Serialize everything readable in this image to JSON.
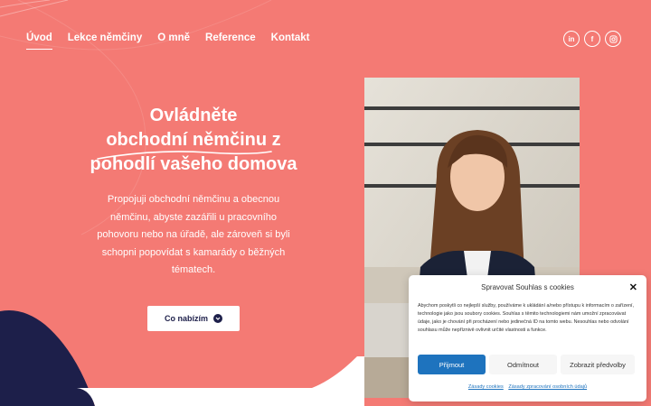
{
  "nav": {
    "items": [
      {
        "label": "Úvod",
        "active": true
      },
      {
        "label": "Lekce němčiny",
        "active": false
      },
      {
        "label": "O mně",
        "active": false
      },
      {
        "label": "Reference",
        "active": false
      },
      {
        "label": "Kontakt",
        "active": false
      }
    ]
  },
  "social": {
    "linkedin": "in",
    "facebook": "f",
    "instagram_icon": "instagram-icon"
  },
  "hero": {
    "title_line1": "Ovládněte",
    "title_line2": "obchodní němčinu z",
    "title_line3": "pohodlí vašeho domova",
    "text": "Propojuji obchodní němčinu a obecnou němčinu, abyste zazářili u pracovního pohovoru nebo na úřadě, ale zároveň si byli schopni popovídat s kamarády o běžných tématech.",
    "cta_label": "Co nabízím"
  },
  "cookie": {
    "title": "Spravovat Souhlas s cookies",
    "body": "Abychom poskytli co nejlepší služby, používáme k ukládání a/nebo přístupu k informacím o zařízení, technologie jako jsou soubory cookies. Souhlas s těmito technologiemi nám umožní zpracovávat údaje, jako je chování při procházení nebo jedinečná ID na tomto webu. Nesouhlas nebo odvolání souhlasu může nepříznivě ovlivnit určité vlastnosti a funkce.",
    "accept_label": "Přijmout",
    "deny_label": "Odmítnout",
    "prefs_label": "Zobrazit předvolby",
    "link_cookies": "Zásady cookies",
    "link_privacy": "Zásady zpracování osobních údajů"
  },
  "colors": {
    "background": "#f47a74",
    "navy": "#1d1f4a",
    "accent_blue": "#1e73be"
  }
}
